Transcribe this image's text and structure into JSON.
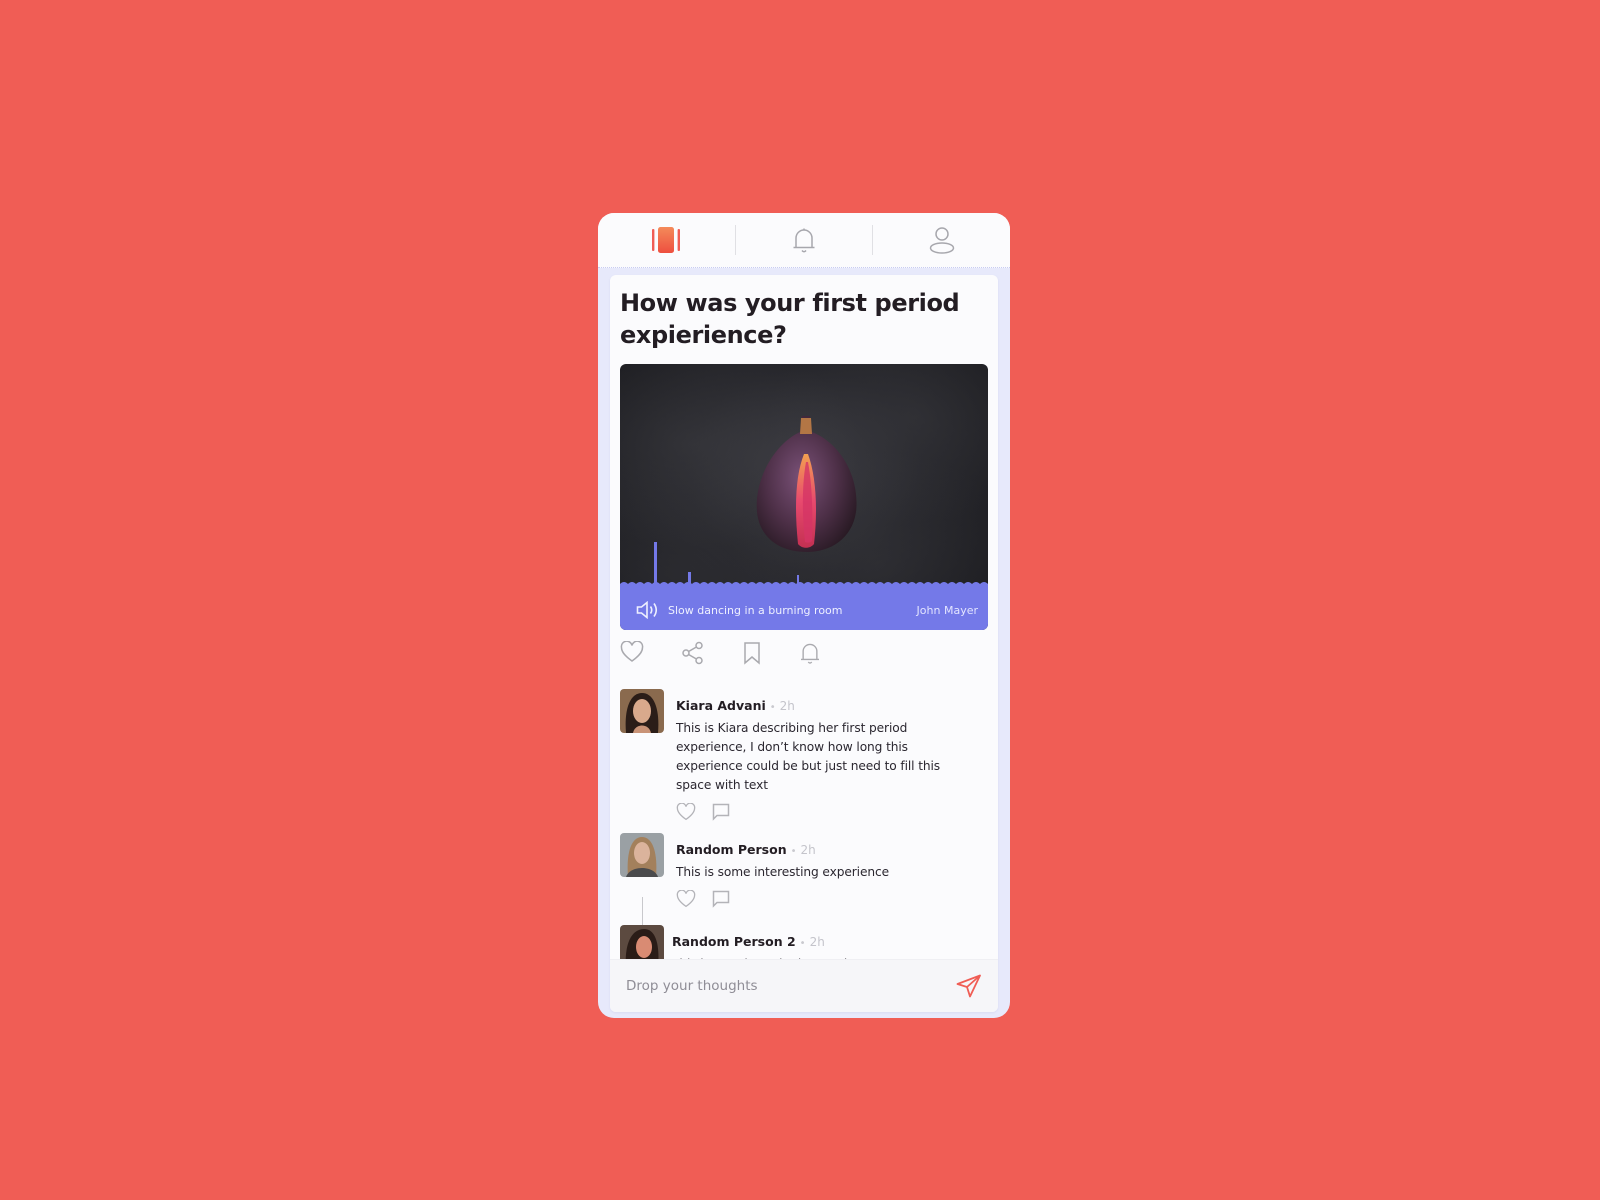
{
  "nav": {
    "tabs": [
      {
        "name": "feed",
        "icon": "cards-icon",
        "active": true
      },
      {
        "name": "notifications",
        "icon": "bell-icon",
        "active": false
      },
      {
        "name": "profile",
        "icon": "user-icon",
        "active": false
      }
    ]
  },
  "colors": {
    "background": "#f05d55",
    "accent": "#f05d55",
    "audio_bar": "#7479e8",
    "frame": "#e7e9fb"
  },
  "post": {
    "question": "How was your first period expierience?",
    "media": {
      "image_subject": "halved fig on dark background",
      "audio": {
        "song": "Slow dancing in a burning room",
        "artist": "John Mayer",
        "icon": "speaker-icon"
      }
    },
    "actions": [
      "heart-icon",
      "share-icon",
      "bookmark-icon",
      "bell-icon"
    ]
  },
  "comments": [
    {
      "name": "Kiara Advani",
      "time": "2h",
      "text": "This is Kiara describing her first period experience, I don’t know how long this experience could be but just need to fill this space with text"
    },
    {
      "name": "Random Person",
      "time": "2h",
      "text": "This is some interesting experience"
    },
    {
      "name": "Random Person 2",
      "time": "2h",
      "text": "This is a reply to the interesting comment"
    }
  ],
  "composer": {
    "placeholder": "Drop your thoughts",
    "value": ""
  }
}
